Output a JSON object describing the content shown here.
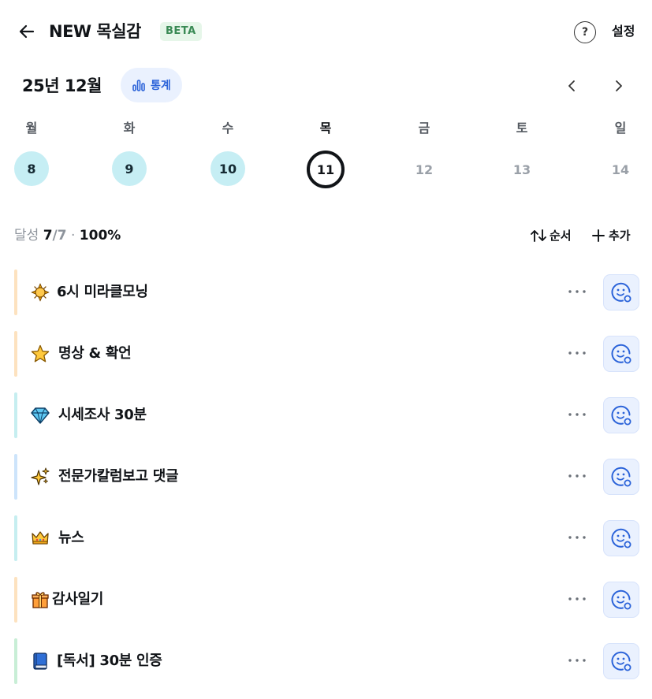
{
  "header": {
    "title": "NEW 목실감",
    "badge": "BETA",
    "help_icon": "question-circle-icon",
    "help_label": "?",
    "settings_label": "설정"
  },
  "month": {
    "label": "25년 12월",
    "stats_label": "통계",
    "stats_icon": "bar-chart-icon"
  },
  "week": {
    "days": [
      {
        "dow": "월",
        "date": "8",
        "state": "done"
      },
      {
        "dow": "화",
        "date": "9",
        "state": "done"
      },
      {
        "dow": "수",
        "date": "10",
        "state": "done"
      },
      {
        "dow": "목",
        "date": "11",
        "state": "today"
      },
      {
        "dow": "금",
        "date": "12",
        "state": "future"
      },
      {
        "dow": "토",
        "date": "13",
        "state": "future"
      },
      {
        "dow": "일",
        "date": "14",
        "state": "future"
      }
    ]
  },
  "summary": {
    "label": "달성",
    "done": "7",
    "total": "/7",
    "separator": "·",
    "percent": "100%",
    "order_label": "순서",
    "add_label": "추가"
  },
  "tasks": [
    {
      "icon": "sun-icon",
      "name": "6시 미라클모닝",
      "color": "#fde2bf"
    },
    {
      "icon": "star-icon",
      "name": "명상 & 확언",
      "color": "#fde2bf"
    },
    {
      "icon": "gem-icon",
      "name": "시세조사 30분",
      "color": "#c6eef0"
    },
    {
      "icon": "sparkles-icon",
      "name": "전문가칼럼보고 댓글",
      "color": "#cde4fb"
    },
    {
      "icon": "crown-icon",
      "name": "뉴스",
      "color": "#c6eef0"
    },
    {
      "icon": "gift-icon",
      "name": "감사일기",
      "color": "#fde2bf"
    },
    {
      "icon": "book-icon",
      "name": "[독서] 30분 인증",
      "color": "#c8eed6"
    }
  ],
  "colors": {
    "accent_blue": "#2b63d9",
    "done_circle": "#c6eef4",
    "beta_bg": "#e6f6e9",
    "beta_text": "#3a8a55"
  }
}
